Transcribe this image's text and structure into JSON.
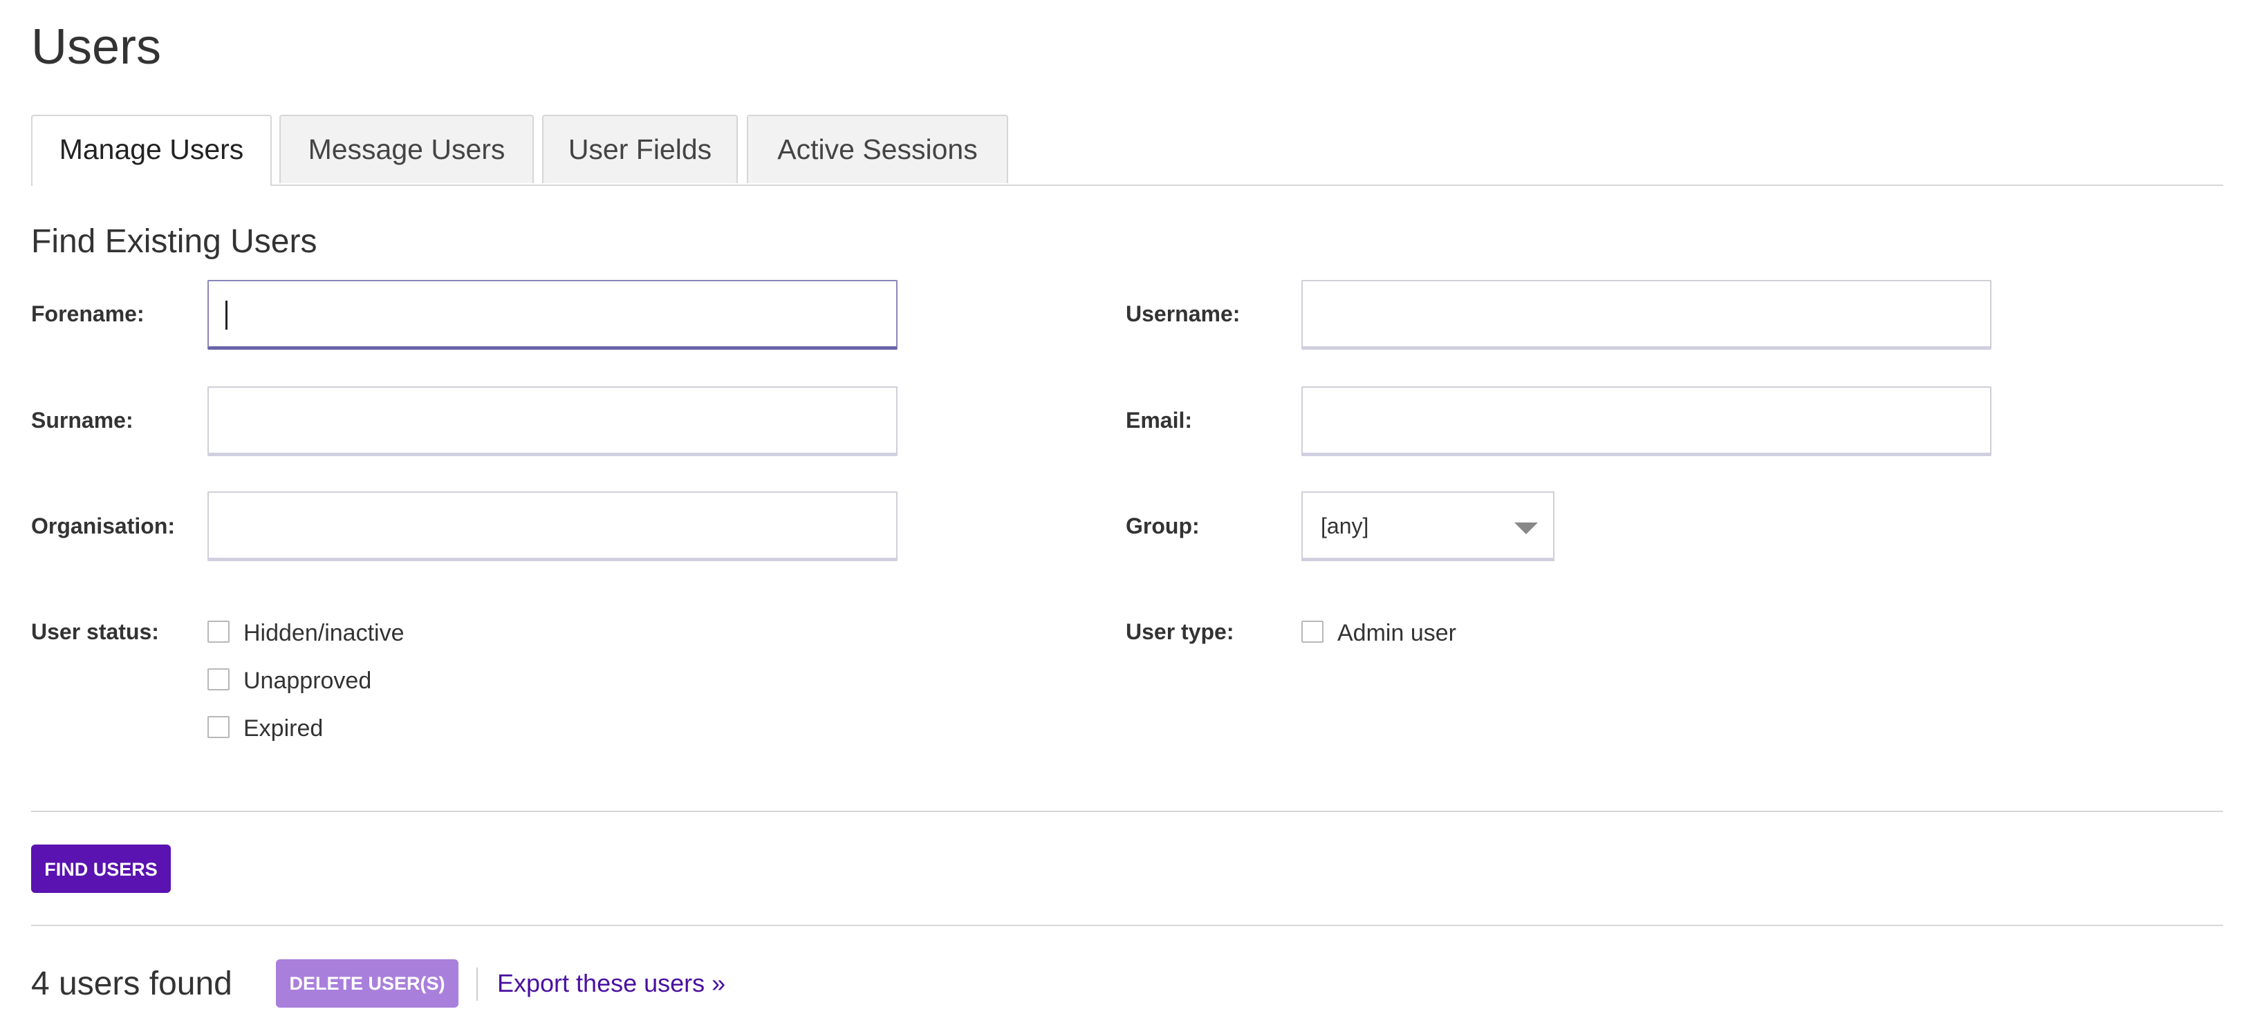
{
  "page": {
    "title": "Users"
  },
  "tabs": [
    {
      "label": "Manage Users",
      "active": true
    },
    {
      "label": "Message Users",
      "active": false
    },
    {
      "label": "User Fields",
      "active": false
    },
    {
      "label": "Active Sessions",
      "active": false
    }
  ],
  "search": {
    "title": "Find Existing Users",
    "forename": {
      "label": "Forename:",
      "value": ""
    },
    "surname": {
      "label": "Surname:",
      "value": ""
    },
    "organisation": {
      "label": "Organisation:",
      "value": ""
    },
    "username": {
      "label": "Username:",
      "value": ""
    },
    "email": {
      "label": "Email:",
      "value": ""
    },
    "group": {
      "label": "Group:",
      "selected": "[any]"
    },
    "user_status": {
      "label": "User status:",
      "options": [
        {
          "label": "Hidden/inactive",
          "checked": false
        },
        {
          "label": "Unapproved",
          "checked": false
        },
        {
          "label": "Expired",
          "checked": false
        }
      ]
    },
    "user_type": {
      "label": "User type:",
      "options": [
        {
          "label": "Admin user",
          "checked": false
        }
      ]
    },
    "find_button": "FIND USERS"
  },
  "results": {
    "count_text": "4 users found",
    "delete_button": "DELETE USER(S)",
    "export_link": "Export these users »"
  },
  "colors": {
    "primary": "#5a12b0",
    "primary_disabled": "#a97fdc",
    "link": "#4a10a0"
  }
}
